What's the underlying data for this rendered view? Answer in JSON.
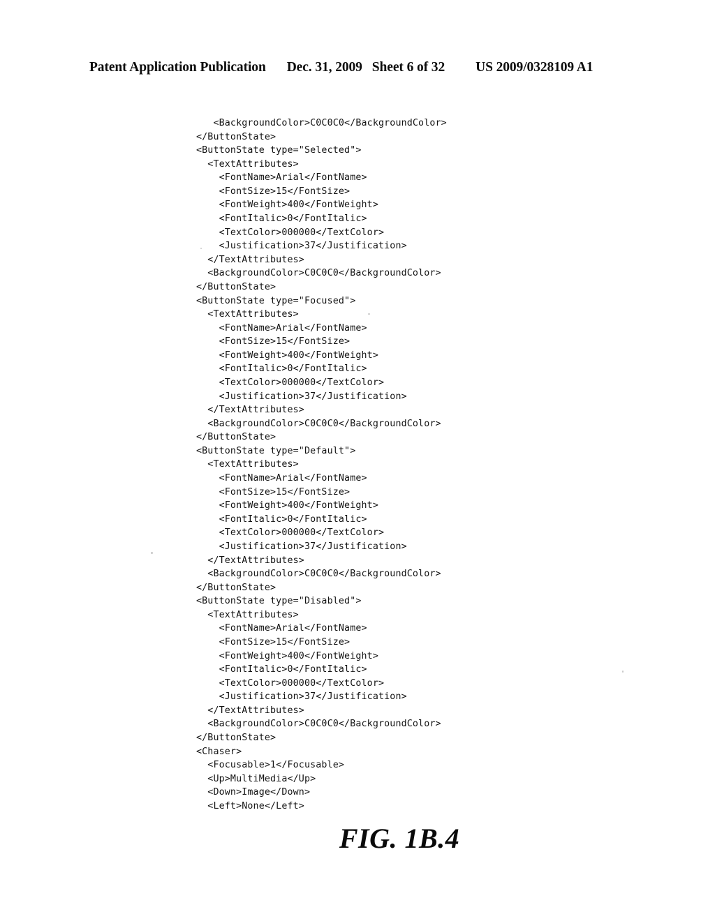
{
  "header": {
    "publication": "Patent Application Publication",
    "date": "Dec. 31, 2009",
    "sheet": "Sheet 6 of 32",
    "document_number": "US 2009/0328109 A1"
  },
  "figure": {
    "caption": "FIG. 1B.4"
  },
  "listing": {
    "language": "xml",
    "lines": [
      "   <BackgroundColor>C0C0C0</BackgroundColor>",
      "</ButtonState>",
      "<ButtonState type=\"Selected\">",
      "  <TextAttributes>",
      "    <FontName>Arial</FontName>",
      "    <FontSize>15</FontSize>",
      "    <FontWeight>400</FontWeight>",
      "    <FontItalic>0</FontItalic>",
      "    <TextColor>000000</TextColor>",
      "    <Justification>37</Justification>",
      "  </TextAttributes>",
      "  <BackgroundColor>C0C0C0</BackgroundColor>",
      "</ButtonState>",
      "<ButtonState type=\"Focused\">",
      "  <TextAttributes>",
      "    <FontName>Arial</FontName>",
      "    <FontSize>15</FontSize>",
      "    <FontWeight>400</FontWeight>",
      "    <FontItalic>0</FontItalic>",
      "    <TextColor>000000</TextColor>",
      "    <Justification>37</Justification>",
      "  </TextAttributes>",
      "  <BackgroundColor>C0C0C0</BackgroundColor>",
      "</ButtonState>",
      "<ButtonState type=\"Default\">",
      "  <TextAttributes>",
      "    <FontName>Arial</FontName>",
      "    <FontSize>15</FontSize>",
      "    <FontWeight>400</FontWeight>",
      "    <FontItalic>0</FontItalic>",
      "    <TextColor>000000</TextColor>",
      "    <Justification>37</Justification>",
      "  </TextAttributes>",
      "  <BackgroundColor>C0C0C0</BackgroundColor>",
      "</ButtonState>",
      "<ButtonState type=\"Disabled\">",
      "  <TextAttributes>",
      "    <FontName>Arial</FontName>",
      "    <FontSize>15</FontSize>",
      "    <FontWeight>400</FontWeight>",
      "    <FontItalic>0</FontItalic>",
      "    <TextColor>000000</TextColor>",
      "    <Justification>37</Justification>",
      "  </TextAttributes>",
      "  <BackgroundColor>C0C0C0</BackgroundColor>",
      "</ButtonState>",
      "<Chaser>",
      "  <Focusable>1</Focusable>",
      "  <Up>MultiMedia</Up>",
      "  <Down>Image</Down>",
      "  <Left>None</Left>"
    ]
  }
}
